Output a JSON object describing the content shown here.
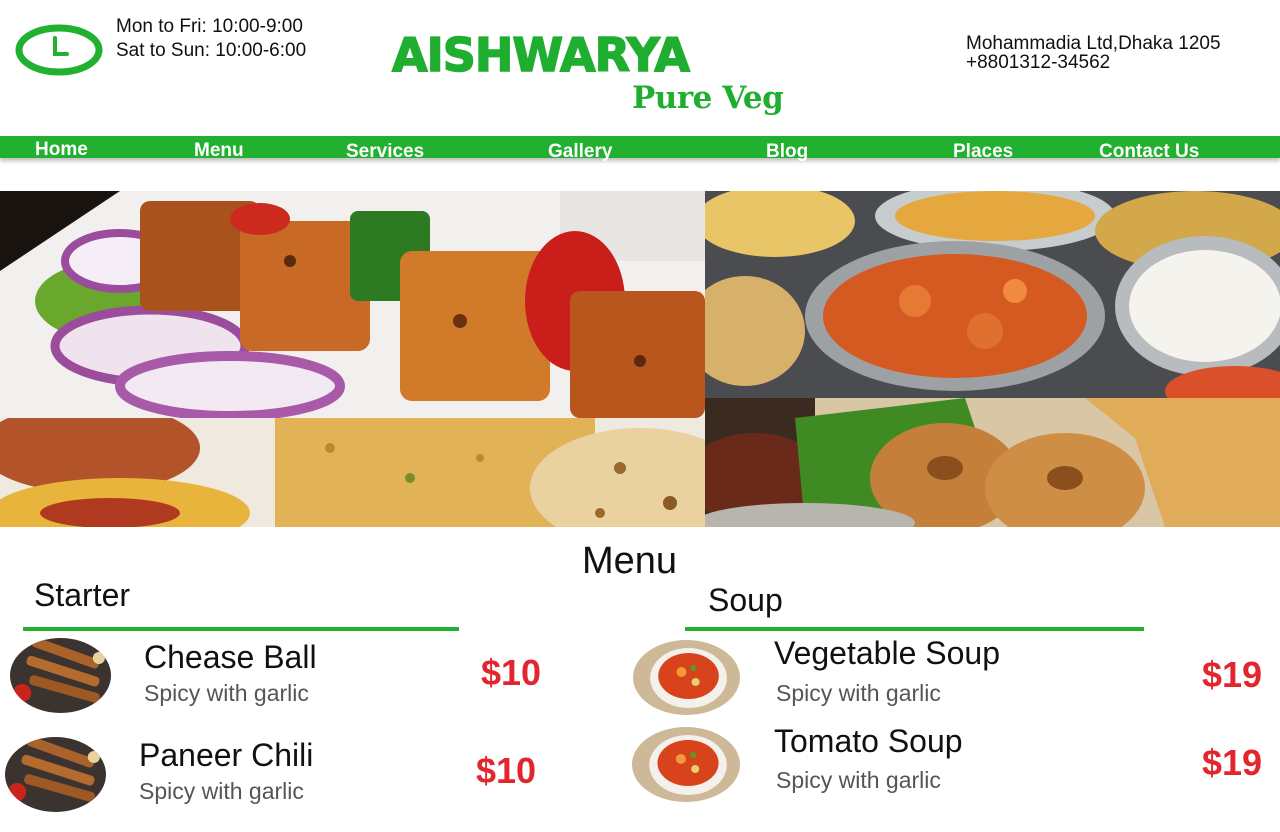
{
  "header": {
    "hours": [
      "Mon to Fri: 10:00-9:00",
      "Sat to Sun: 10:00-6:00"
    ],
    "brand_name": "AISHWARYA",
    "brand_tagline": "Pure Veg",
    "address": "Mohammadia Ltd,Dhaka 1205",
    "phone": "+8801312-34562",
    "accent_color": "#22b030"
  },
  "nav": {
    "items": [
      {
        "label": "Home"
      },
      {
        "label": "Menu"
      },
      {
        "label": "Services"
      },
      {
        "label": "Gallery"
      },
      {
        "label": "Blog"
      },
      {
        "label": "Places"
      },
      {
        "label": "Contact Us"
      }
    ]
  },
  "banner": {
    "photos": [
      "paneer-tikka-photo",
      "curry-thali-photo",
      "pulao-naan-photo",
      "vada-dosa-photo"
    ]
  },
  "menu": {
    "title": "Menu",
    "price_color": "#e3262e",
    "sections": [
      {
        "heading": "Starter",
        "items": [
          {
            "name": "Chease Ball",
            "description": "Spicy with garlic",
            "price": "$10",
            "image": "skewers-photo"
          },
          {
            "name": "Paneer Chili",
            "description": "Spicy with garlic",
            "price": "$10",
            "image": "skewers-photo"
          }
        ]
      },
      {
        "heading": "Soup",
        "items": [
          {
            "name": "Vegetable Soup",
            "description": "Spicy with garlic",
            "price": "$19",
            "image": "soup-bowl-photo"
          },
          {
            "name": "Tomato Soup",
            "description": "Spicy with garlic",
            "price": "$19",
            "image": "soup-bowl-photo"
          }
        ]
      }
    ]
  }
}
